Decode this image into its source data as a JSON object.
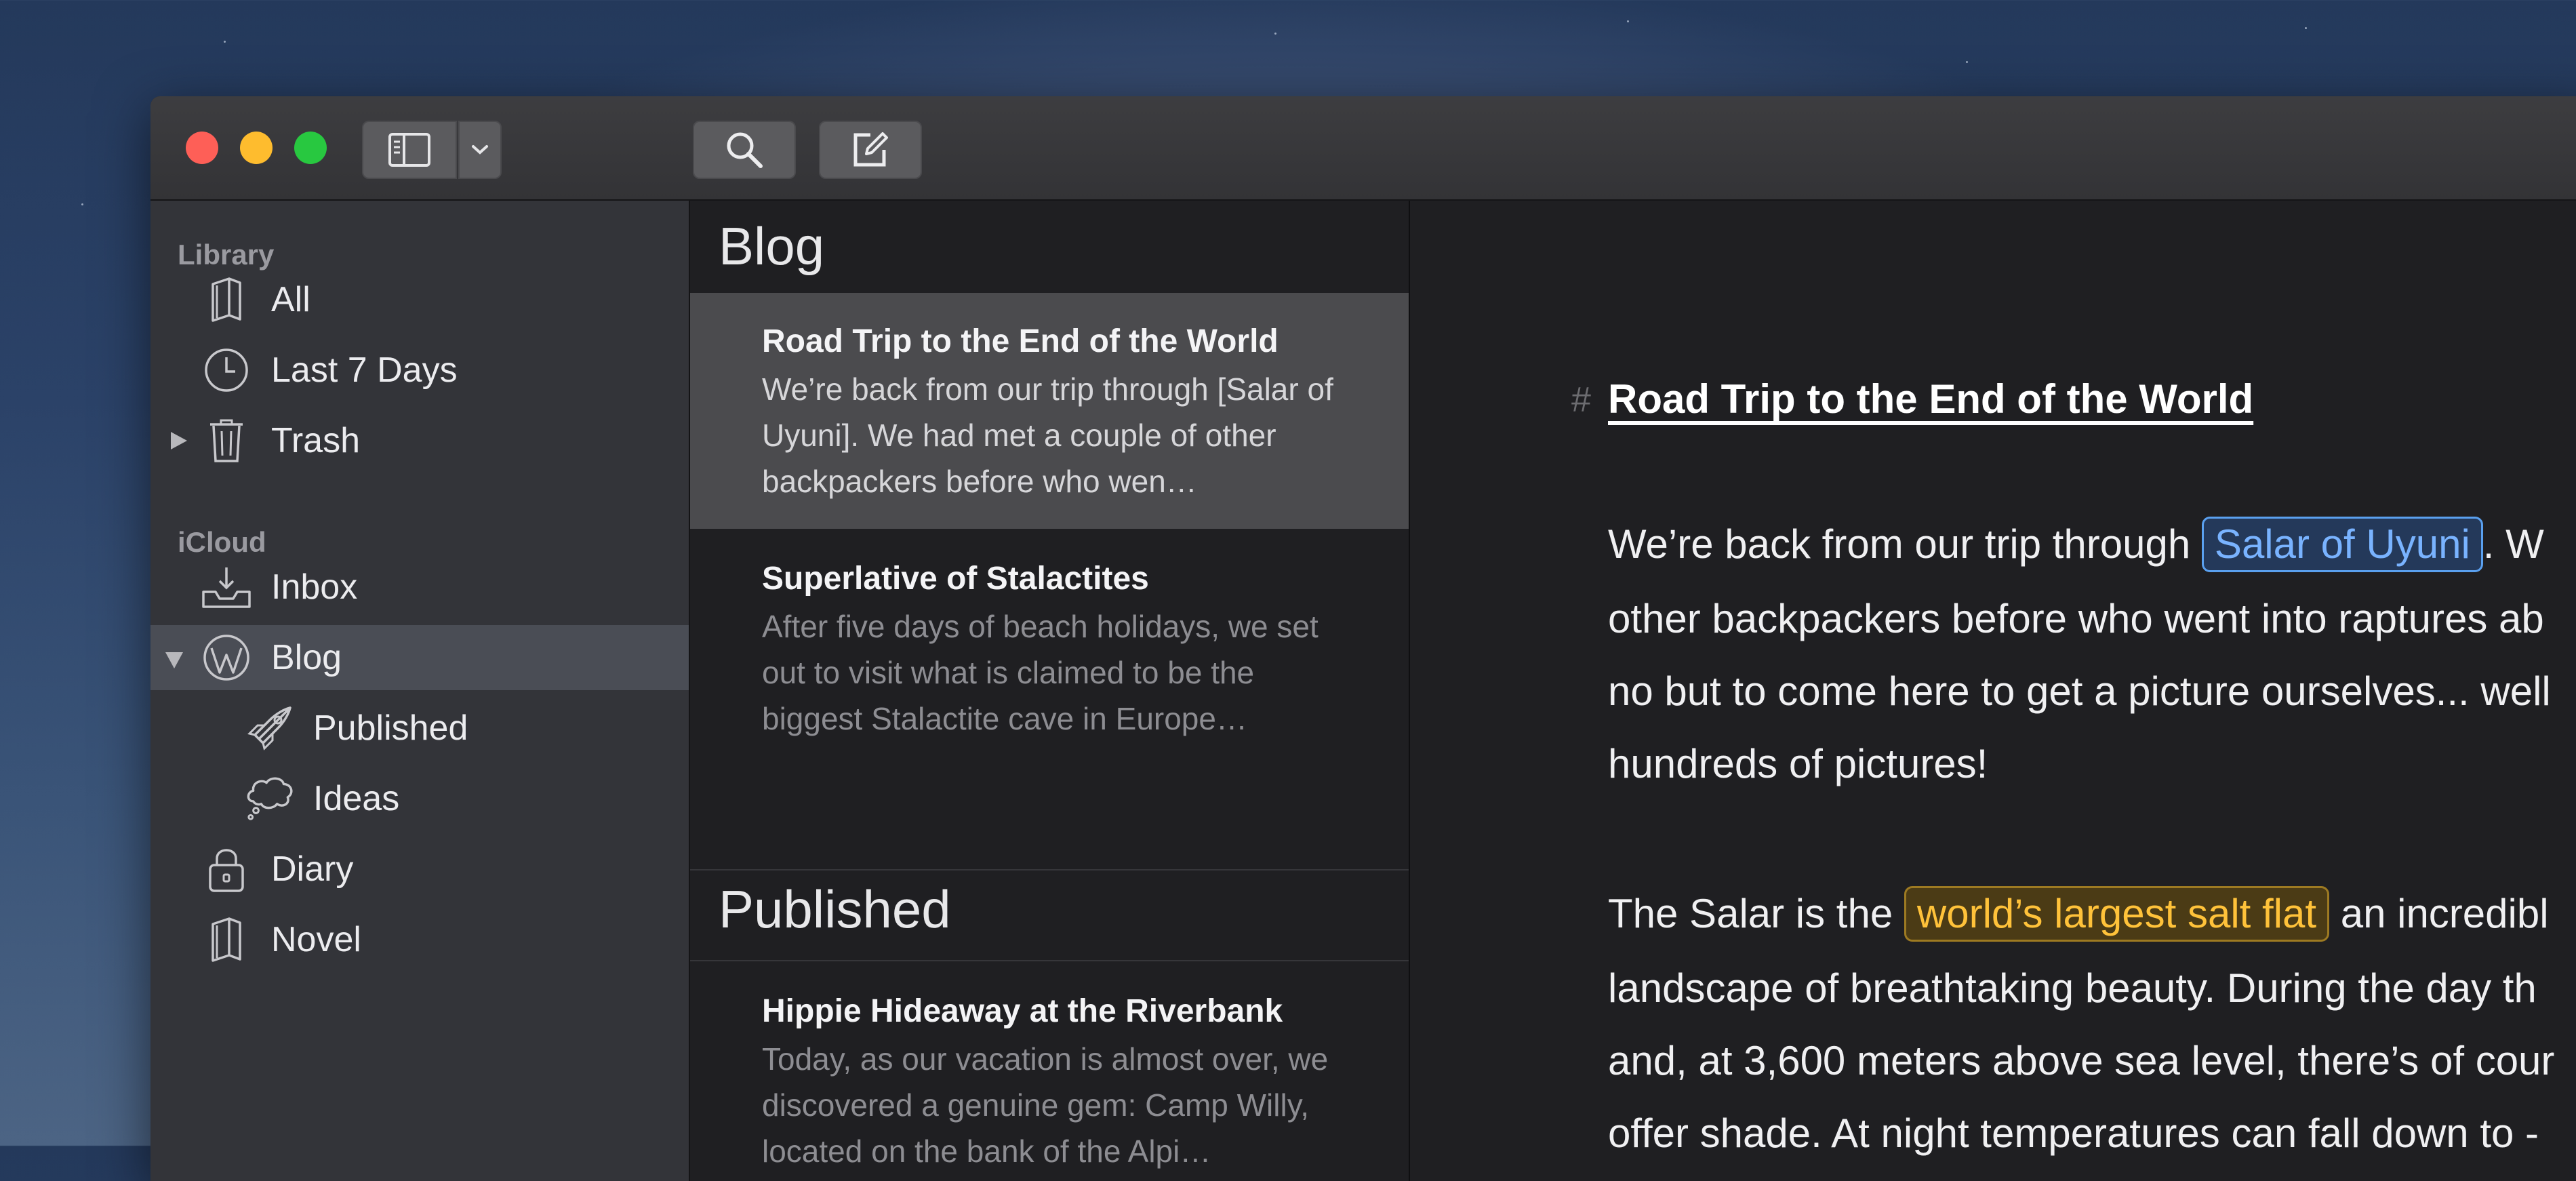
{
  "toolbar": {
    "icons": [
      "sidebar-icon",
      "chevron-down-icon",
      "search-icon",
      "compose-icon"
    ]
  },
  "sidebar": {
    "library_header": "Library",
    "icloud_header": "iCloud",
    "library_items": [
      {
        "label": "All",
        "icon": "notebook-icon"
      },
      {
        "label": "Last 7 Days",
        "icon": "clock-icon"
      },
      {
        "label": "Trash",
        "icon": "trash-icon"
      }
    ],
    "icloud_items": [
      {
        "label": "Inbox",
        "icon": "inbox-icon"
      },
      {
        "label": "Blog",
        "icon": "wordpress-icon",
        "selected": true
      },
      {
        "label": "Published",
        "icon": "rocket-icon"
      },
      {
        "label": "Ideas",
        "icon": "thought-bubble-icon"
      },
      {
        "label": "Diary",
        "icon": "lock-icon"
      },
      {
        "label": "Novel",
        "icon": "notebook-icon"
      }
    ]
  },
  "notelist": {
    "header_blog": "Blog",
    "header_published": "Published",
    "notes": [
      {
        "title": "Road Trip to the End of the World",
        "snippet": "We’re back from our trip through [Salar of Uyuni]. We had met a couple of other backpackers before who wen…",
        "selected": true
      },
      {
        "title": "Superlative of Stalactites",
        "snippet": "After five days of beach holidays, we set out to visit what is claimed to be the biggest Stalactite cave in Europe…"
      },
      {
        "title": "Hippie Hideaway at the Riverbank",
        "snippet": "Today, as our vacation is almost over, we discovered a genuine gem: Camp Willy, located on the bank of the Alpi…"
      }
    ]
  },
  "editor": {
    "hash": "#",
    "title": "Road Trip to the End of the World",
    "p1_prefix": "We’re back from our trip through",
    "p1_link": "Salar of Uyuni",
    "p1_suffix": ". W",
    "p1_line2": "other backpackers before who went into raptures ab",
    "p1_line3": "no but to come here to get a picture ourselves... well",
    "p1_line4": "hundreds of pictures!",
    "p2_prefix": "The Salar is the",
    "p2_highlight": "world’s largest salt flat",
    "p2_suffix": "an incredibl",
    "p2_line2": "landscape of breathtaking beauty. During the day th",
    "p2_line3": "and, at 3,600 meters above sea level, there’s of cour",
    "p2_line4": "offer shade. At night temperatures can fall down to -"
  },
  "colors": {
    "close": "#fe5f57",
    "minimize": "#febc2e",
    "maximize": "#28c840",
    "link": "#79b3ff",
    "highlight": "#ffc23a"
  }
}
